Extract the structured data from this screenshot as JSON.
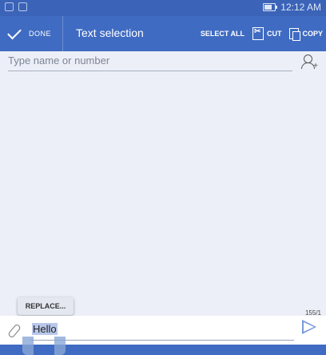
{
  "status_bar": {
    "time": "12:12 AM"
  },
  "action_bar": {
    "done_label": "DONE",
    "title": "Text selection",
    "select_all_label": "SELECT ALL",
    "cut_label": "CUT",
    "copy_label": "COPY"
  },
  "recipient": {
    "placeholder": "Type name or number"
  },
  "popup": {
    "replace_label": "REPLACE..."
  },
  "composer": {
    "counter": "155/1",
    "message": "Hello"
  },
  "colors": {
    "primary": "#3f6bc2",
    "background": "#eceff7",
    "selection": "#b8c7ea"
  },
  "icons": [
    "check-icon",
    "cut-icon",
    "copy-icon",
    "add-contact-icon",
    "attach-icon",
    "send-icon"
  ]
}
